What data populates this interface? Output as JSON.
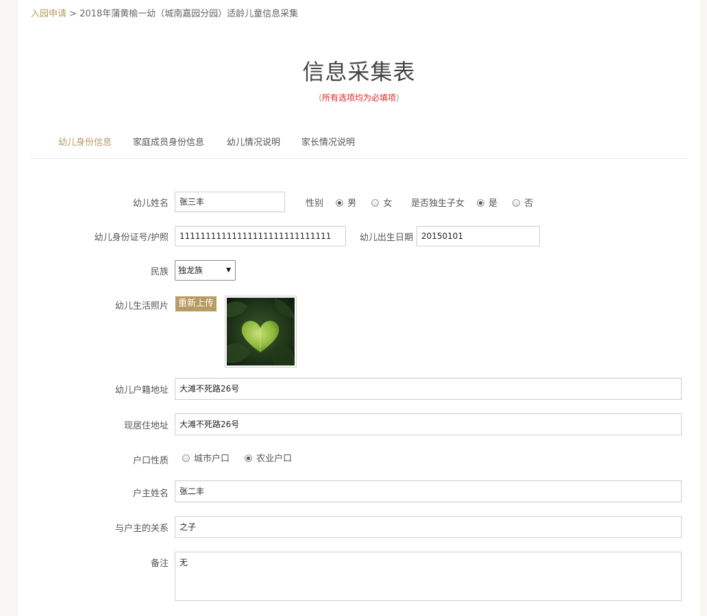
{
  "breadcrumb": {
    "link": "入园申请",
    "separator": " > ",
    "current": "2018年蒲黄榆一幼（城南嘉园分园）适龄儿童信息采集"
  },
  "page": {
    "title": "信息采集表",
    "note_open": "(",
    "note": "所有选项均为必填项",
    "note_close": ")"
  },
  "tabs": [
    {
      "label": "幼儿身份信息",
      "active": true
    },
    {
      "label": "家庭成员身份信息",
      "active": false
    },
    {
      "label": "幼儿情况说明",
      "active": false
    },
    {
      "label": "家长情况说明",
      "active": false
    }
  ],
  "form": {
    "child_name": {
      "label": "幼儿姓名",
      "value": "张三丰"
    },
    "gender": {
      "label": "性别",
      "options": [
        "男",
        "女"
      ],
      "selected": "男"
    },
    "only_child": {
      "label": "是否独生子女",
      "options": [
        "是",
        "否"
      ],
      "selected": "是"
    },
    "id_number": {
      "label": "幼儿身份证号/护照",
      "value": "11111111111111111111111111111"
    },
    "birth_date": {
      "label": "幼儿出生日期",
      "value": "20150101"
    },
    "ethnicity": {
      "label": "民族",
      "value": "独龙族"
    },
    "photo": {
      "label": "幼儿生活照片",
      "button": "重新上传"
    },
    "household_address": {
      "label": "幼儿户籍地址",
      "value": "大滩不死路26号"
    },
    "current_address": {
      "label": "现居住地址",
      "value": "大滩不死路26号"
    },
    "household_type": {
      "label": "户口性质",
      "options": [
        "城市户口",
        "农业户口"
      ],
      "selected": "农业户口"
    },
    "householder_name": {
      "label": "户主姓名",
      "value": "张二丰"
    },
    "relation": {
      "label": "与户主的关系",
      "value": "之子"
    },
    "remarks": {
      "label": "备注",
      "value": "无"
    }
  },
  "colors": {
    "accent": "#b89b63",
    "required_note": "#e02020"
  }
}
